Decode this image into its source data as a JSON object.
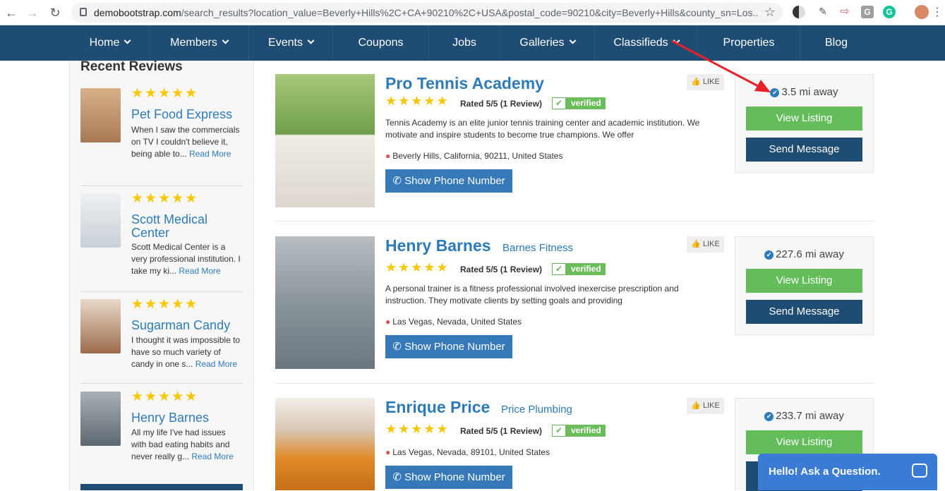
{
  "browser": {
    "url_host": "demobootstrap.com",
    "url_rest": "/search_results?location_value=Beverly+Hills%2C+CA+90210%2C+USA&postal_code=90210&city=Beverly+Hills&county_sn=Los..."
  },
  "nav": {
    "items": [
      {
        "label": "Home",
        "caret": true
      },
      {
        "label": "Members",
        "caret": true
      },
      {
        "label": "Events",
        "caret": true
      },
      {
        "label": "Coupons",
        "caret": false
      },
      {
        "label": "Jobs",
        "caret": false
      },
      {
        "label": "Galleries",
        "caret": true
      },
      {
        "label": "Classifieds",
        "caret": true
      },
      {
        "label": "Properties",
        "caret": false
      },
      {
        "label": "Blog",
        "caret": false
      }
    ]
  },
  "sidebar": {
    "title": "Recent Reviews",
    "reviews": [
      {
        "stars": "★★★★★",
        "name": "Pet Food Express",
        "text": "When I saw the commercials on TV I couldn't believe it, being able to...",
        "more": "Read More",
        "thumb_color": "#c9a27a"
      },
      {
        "stars": "★★★★★",
        "name": "Scott Medical Center",
        "text": "Scott Medical Center is a very professional institution. I take my ki...",
        "more": "Read More",
        "thumb_color": "#dfe4e8"
      },
      {
        "stars": "★★★★★",
        "name": "Sugarman Candy",
        "text": "I thought it was impossible to have so much variety of candy in one s...",
        "more": "Read More",
        "thumb_color": "#b98b6a"
      },
      {
        "stars": "★★★★★",
        "name": "Henry Barnes",
        "text": "All my life I've had issues with bad eating habits and never really g...",
        "more": "Read More",
        "thumb_color": "#8a8f96"
      }
    ]
  },
  "listings": [
    {
      "name": "Pro Tennis Academy",
      "company": "",
      "stars": "★★★★★",
      "rated": "Rated 5/5 (1 Review)",
      "verified": "verified",
      "description": "Tennis Academy is an elite junior tennis training center and academic institution. We motivate and inspire students to become true champions. We offer",
      "location": "Beverly Hills, California, 90211, United States",
      "phone_label": "Show Phone Number",
      "like": "LIKE",
      "distance": "3.5 mi away",
      "view": "View Listing",
      "message": "Send Message",
      "photo_color": "#6f9e4c"
    },
    {
      "name": "Henry Barnes",
      "company": "Barnes Fitness",
      "stars": "★★★★★",
      "rated": "Rated 5/5 (1 Review)",
      "verified": "verified",
      "description": "A personal trainer is a fitness professional involved inexercise prescription and instruction. They motivate clients by setting goals and providing",
      "location": "Las Vegas, Nevada, United States",
      "phone_label": "Show Phone Number",
      "like": "LIKE",
      "distance": "227.6 mi away",
      "view": "View Listing",
      "message": "Send Message",
      "photo_color": "#7f8a92"
    },
    {
      "name": "Enrique Price",
      "company": "Price Plumbing",
      "stars": "★★★★★",
      "rated": "Rated 5/5 (1 Review)",
      "verified": "verified",
      "description": "",
      "location": "Las Vegas, Nevada, 89101, United States",
      "phone_label": "Show Phone Number",
      "like": "LIKE",
      "distance": "233.7 mi away",
      "view": "View Listing",
      "message": "",
      "photo_color": "#e08a2a"
    }
  ],
  "chat": {
    "label": "Hello! Ask a Question."
  },
  "colors": {
    "nav": "#1e4c73",
    "link": "#2d7bb8",
    "green": "#62bd5a",
    "star": "#f8c700",
    "annotation_arrow": "#e8202a"
  }
}
